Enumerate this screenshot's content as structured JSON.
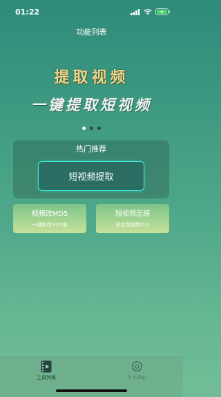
{
  "status_bar": {
    "time": "01:22"
  },
  "nav": {
    "title": "功能列表"
  },
  "banner": {
    "title": "提取视频",
    "subtitle": "一键提取短视频",
    "page_count": 3,
    "active_page": 1
  },
  "hot": {
    "title": "热门推荐",
    "primary_button": "短视频提取"
  },
  "cards": [
    {
      "title": "视频改MD5",
      "subtitle": "一键修改MD5值"
    },
    {
      "title": "短视频压缩",
      "subtitle": "轻松改视频大小"
    }
  ],
  "tabbar": {
    "items": [
      {
        "label": "工具列表",
        "icon": "video-list-icon",
        "active": true
      },
      {
        "label": "个人中心",
        "icon": "gear-icon",
        "active": false
      }
    ]
  },
  "colors": {
    "accent_border": "#3de6d8",
    "banner_title": "#e8d58a"
  }
}
